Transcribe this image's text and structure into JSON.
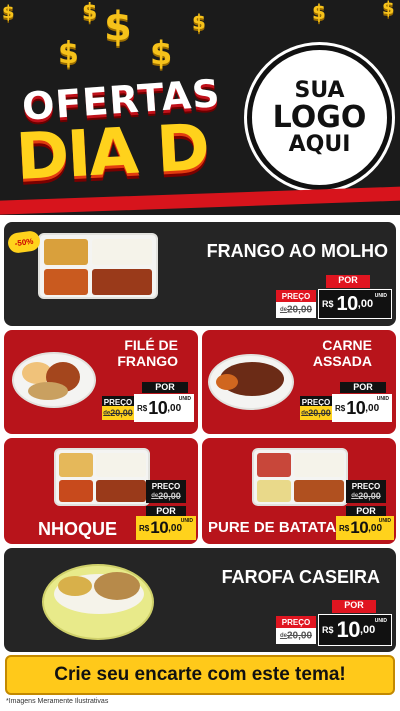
{
  "header": {
    "title_line1": "OFERTAS",
    "title_line2": "DIA D",
    "logo_lines": [
      "SUA",
      "LOGO",
      "AQUI"
    ],
    "decor_glyph": "$"
  },
  "discount_badge": "-50%",
  "products": [
    {
      "name": "FRANGO AO MOLHO",
      "preco_label": "PREÇO",
      "old_price": "20,00",
      "old_prefix": "de",
      "por_label": "POR",
      "currency": "R$",
      "price_int": "10",
      "price_cents": ",00",
      "unit": "UNID"
    },
    {
      "name": "FILÉ DE FRANGO",
      "name_l1": "FILÉ DE",
      "name_l2": "FRANGO",
      "preco_label": "PREÇO",
      "old_price": "20,00",
      "old_prefix": "de",
      "por_label": "POR",
      "currency": "R$",
      "price_int": "10",
      "price_cents": ",00",
      "unit": "UNID"
    },
    {
      "name": "CARNE ASSADA",
      "name_l1": "CARNE",
      "name_l2": "ASSADA",
      "preco_label": "PREÇO",
      "old_price": "20,00",
      "old_prefix": "de",
      "por_label": "POR",
      "currency": "R$",
      "price_int": "10",
      "price_cents": ",00",
      "unit": "UNID"
    },
    {
      "name": "NHOQUE",
      "preco_label": "PREÇO",
      "old_price": "20,00",
      "old_prefix": "de",
      "por_label": "POR",
      "currency": "R$",
      "price_int": "10",
      "price_cents": ",00",
      "unit": "UNID"
    },
    {
      "name": "PURE DE BATATA",
      "preco_label": "PREÇO",
      "old_price": "20,00",
      "old_prefix": "de",
      "por_label": "POR",
      "currency": "R$",
      "price_int": "10",
      "price_cents": ",00",
      "unit": "UNID"
    },
    {
      "name": "FAROFA CASEIRA",
      "preco_label": "PREÇO",
      "old_price": "20,00",
      "old_prefix": "de",
      "por_label": "POR",
      "currency": "R$",
      "price_int": "10",
      "price_cents": ",00",
      "unit": "UNID"
    }
  ],
  "cta": "Crie seu encarte com este tema!",
  "footnote": "*Imagens Meramente Ilustrativas",
  "colors": {
    "dark": "#252525",
    "red": "#b8141b",
    "yellow": "#ffd21c",
    "accent_red": "#e01520"
  }
}
